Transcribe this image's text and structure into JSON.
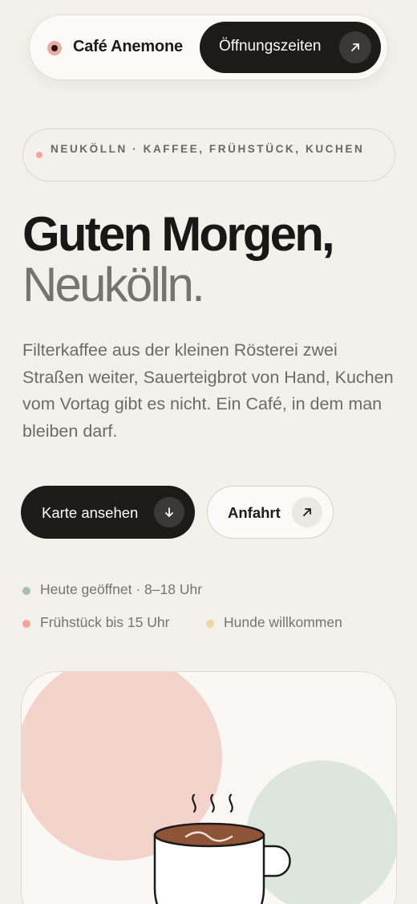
{
  "nav": {
    "brand": "Café Anemone",
    "hours_button": "Öffnungszeiten",
    "arrow_icon": "arrow-up-right-icon"
  },
  "tag": {
    "text": "NEUKÖLLN · KAFFEE, FRÜHSTÜCK, KUCHEN"
  },
  "hero": {
    "title_line1": "Guten Morgen,",
    "title_line2": "Neukölln.",
    "lead": "Filterkaffee aus der kleinen Rösterei zwei Straßen weiter, Sauerteigbrot von Hand, Kuchen vom Vortag gibt es nicht. Ein Café, in dem man bleiben darf."
  },
  "buttons": {
    "menu": "Karte ansehen",
    "menu_icon": "arrow-down-icon",
    "directions": "Anfahrt",
    "directions_icon": "arrow-up-right-icon"
  },
  "info": {
    "open": "Heute geöffnet · 8–18 Uhr",
    "breakfast": "Frühstück bis 15 Uhr",
    "dogs": "Hunde willkommen"
  },
  "colors": {
    "background": "#f4f1ec",
    "dark": "#1d1b19",
    "pink": "#f0a8a2",
    "green": "#a9bfae",
    "yellow": "#ecd99a",
    "coffee": "#8e5437"
  }
}
